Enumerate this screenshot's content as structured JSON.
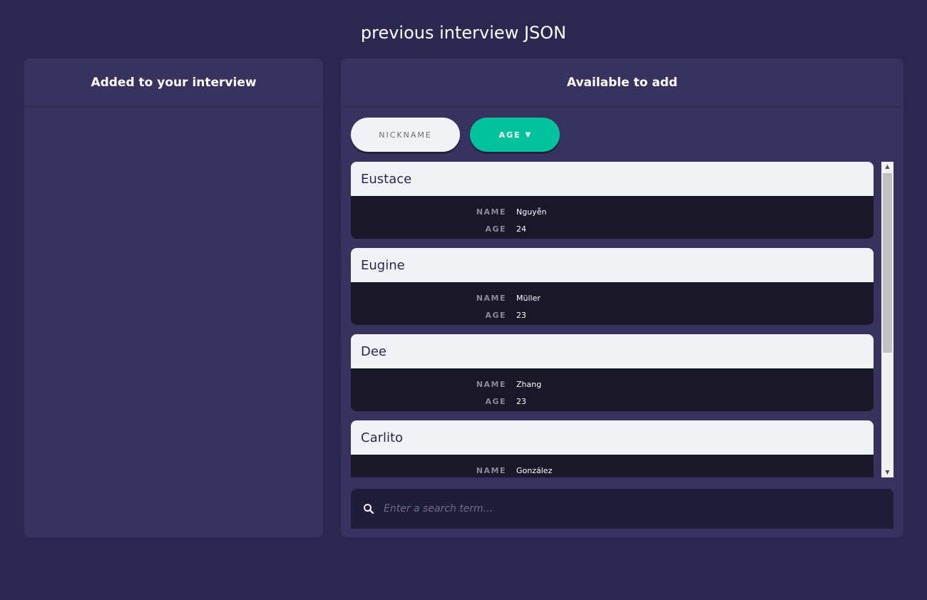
{
  "page": {
    "title": "previous interview JSON"
  },
  "left_panel": {
    "title": "Added to your interview"
  },
  "right_panel": {
    "title": "Available to add",
    "sort_buttons": [
      {
        "label": "NICKNAME",
        "active": false
      },
      {
        "label": "AGE",
        "active": true,
        "direction_icon": "▼"
      }
    ],
    "field_labels": {
      "name": "NAME",
      "age": "AGE"
    },
    "cards": [
      {
        "nickname": "Eustace",
        "name": "Nguyễn",
        "age": "24"
      },
      {
        "nickname": "Eugine",
        "name": "Müller",
        "age": "23"
      },
      {
        "nickname": "Dee",
        "name": "Zhang",
        "age": "23"
      },
      {
        "nickname": "Carlito",
        "name": "González",
        "age": ""
      }
    ],
    "search": {
      "placeholder": "Enter a search term...",
      "value": ""
    }
  },
  "colors": {
    "background": "#2b2850",
    "panel": "#37325e",
    "accent": "#00c29c",
    "card_header": "#eff3f5",
    "card_body": "#1a1729"
  },
  "icons": {
    "search": "search-icon",
    "sort_direction": "caret-down-icon"
  }
}
